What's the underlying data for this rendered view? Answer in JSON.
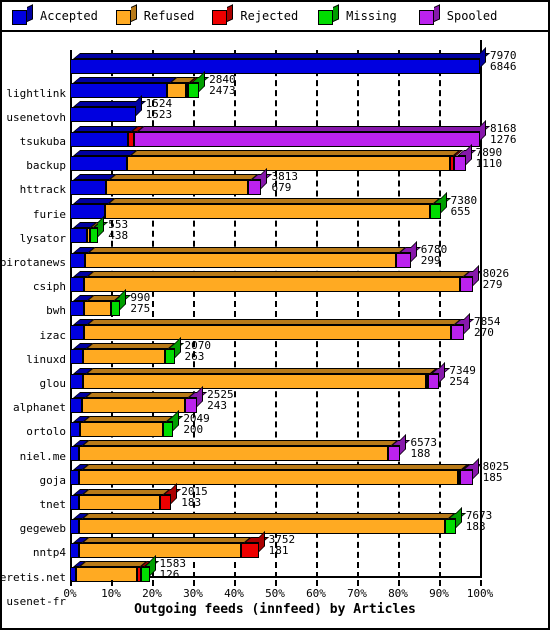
{
  "legend": {
    "items": [
      {
        "label": "Accepted",
        "color": "#0000e0",
        "name": "legend-accepted"
      },
      {
        "label": "Refused",
        "color": "#ffaa22",
        "name": "legend-refused"
      },
      {
        "label": "Rejected",
        "color": "#ee0000",
        "name": "legend-rejected"
      },
      {
        "label": "Missing",
        "color": "#00dd00",
        "name": "legend-missing"
      },
      {
        "label": "Spooled",
        "color": "#bb22ee",
        "name": "legend-spooled"
      }
    ]
  },
  "chart_data": {
    "type": "bar",
    "orientation": "horizontal",
    "stacked": true,
    "title": "Outgoing feeds (innfeed) by Articles",
    "xlabel": "Outgoing feeds (innfeed) by Articles",
    "ylabel": "",
    "xlim": [
      0,
      100
    ],
    "xunit": "%",
    "grid": true,
    "legend_position": "top",
    "xticks": [
      "0%",
      "10%",
      "20%",
      "30%",
      "40%",
      "50%",
      "60%",
      "70%",
      "80%",
      "90%",
      "100%"
    ],
    "xtick_values": [
      0,
      10,
      20,
      30,
      40,
      50,
      60,
      70,
      80,
      90,
      100
    ],
    "series": [
      {
        "name": "Accepted",
        "color": "#0000e0"
      },
      {
        "name": "Refused",
        "color": "#ffaa22"
      },
      {
        "name": "Rejected",
        "color": "#ee0000"
      },
      {
        "name": "Missing",
        "color": "#00dd00"
      },
      {
        "name": "Spooled",
        "color": "#bb22ee"
      }
    ],
    "categories": [
      "lightlink",
      "usenetovh",
      "tsukuba",
      "backup",
      "httrack",
      "furie",
      "lysator",
      "birotanews",
      "csiph",
      "bwh",
      "izac",
      "linuxd",
      "glou",
      "alphanet",
      "ortolo",
      "niel.me",
      "goja",
      "tnet",
      "gegeweb",
      "nntp4",
      "weretis.net",
      "usenet-fr"
    ],
    "rows": [
      {
        "label": "lightlink",
        "value_top": "7970",
        "value_bottom": "6846",
        "total_pct": 100.0,
        "segments": [
          {
            "series": "Accepted",
            "pct": 100.0
          }
        ]
      },
      {
        "label": "usenetovh",
        "value_top": "2840",
        "value_bottom": "2473",
        "total_pct": 31.5,
        "segments": [
          {
            "series": "Accepted",
            "pct": 23.6
          },
          {
            "series": "Refused",
            "pct": 4.6
          },
          {
            "series": "Rejected",
            "pct": 0.7
          },
          {
            "series": "Missing",
            "pct": 2.6
          }
        ]
      },
      {
        "label": "tsukuba",
        "value_top": "1524",
        "value_bottom": "1523",
        "total_pct": 16.0,
        "segments": [
          {
            "series": "Accepted",
            "pct": 16.0
          }
        ]
      },
      {
        "label": "backup",
        "value_top": "8168",
        "value_bottom": "1276",
        "total_pct": 100.0,
        "segments": [
          {
            "series": "Accepted",
            "pct": 14.1
          },
          {
            "series": "Rejected",
            "pct": 1.5
          },
          {
            "series": "Spooled",
            "pct": 84.4
          }
        ]
      },
      {
        "label": "httrack",
        "value_top": "7890",
        "value_bottom": "1110",
        "total_pct": 96.5,
        "segments": [
          {
            "series": "Accepted",
            "pct": 13.9
          },
          {
            "series": "Refused",
            "pct": 78.9
          },
          {
            "series": "Rejected",
            "pct": 0.8
          },
          {
            "series": "Spooled",
            "pct": 2.9
          }
        ]
      },
      {
        "label": "furie",
        "value_top": "3813",
        "value_bottom": "679",
        "total_pct": 46.7,
        "segments": [
          {
            "series": "Accepted",
            "pct": 8.8
          },
          {
            "series": "Refused",
            "pct": 34.6
          },
          {
            "series": "Spooled",
            "pct": 3.3
          }
        ]
      },
      {
        "label": "lysator",
        "value_top": "7380",
        "value_bottom": "655",
        "total_pct": 90.4,
        "segments": [
          {
            "series": "Accepted",
            "pct": 8.6
          },
          {
            "series": "Refused",
            "pct": 79.2
          },
          {
            "series": "Missing",
            "pct": 2.6
          }
        ]
      },
      {
        "label": "birotanews",
        "value_top": "553",
        "value_bottom": "438",
        "total_pct": 6.9,
        "segments": [
          {
            "series": "Accepted",
            "pct": 4.1
          },
          {
            "series": "Refused",
            "pct": 0.8
          },
          {
            "series": "Missing",
            "pct": 2.0
          }
        ]
      },
      {
        "label": "csiph",
        "value_top": "6780",
        "value_bottom": "299",
        "total_pct": 83.1,
        "segments": [
          {
            "series": "Accepted",
            "pct": 3.6
          },
          {
            "series": "Refused",
            "pct": 75.9
          },
          {
            "series": "Spooled",
            "pct": 3.6
          }
        ]
      },
      {
        "label": "bwh",
        "value_top": "8026",
        "value_bottom": "279",
        "total_pct": 98.2,
        "segments": [
          {
            "series": "Accepted",
            "pct": 3.4
          },
          {
            "series": "Refused",
            "pct": 91.8
          },
          {
            "series": "Spooled",
            "pct": 3.0
          }
        ]
      },
      {
        "label": "izac",
        "value_top": "990",
        "value_bottom": "275",
        "total_pct": 12.3,
        "segments": [
          {
            "series": "Accepted",
            "pct": 3.3
          },
          {
            "series": "Refused",
            "pct": 6.6
          },
          {
            "series": "Missing",
            "pct": 2.4
          }
        ]
      },
      {
        "label": "linuxd",
        "value_top": "7854",
        "value_bottom": "270",
        "total_pct": 96.1,
        "segments": [
          {
            "series": "Accepted",
            "pct": 3.3
          },
          {
            "series": "Refused",
            "pct": 89.6
          },
          {
            "series": "Spooled",
            "pct": 3.2
          }
        ]
      },
      {
        "label": "glou",
        "value_top": "2070",
        "value_bottom": "263",
        "total_pct": 25.5,
        "segments": [
          {
            "series": "Accepted",
            "pct": 3.2
          },
          {
            "series": "Refused",
            "pct": 20.0
          },
          {
            "series": "Missing",
            "pct": 2.3
          }
        ]
      },
      {
        "label": "alphanet",
        "value_top": "7349",
        "value_bottom": "254",
        "total_pct": 90.1,
        "segments": [
          {
            "series": "Accepted",
            "pct": 3.1
          },
          {
            "series": "Refused",
            "pct": 83.8
          },
          {
            "series": "Rejected",
            "pct": 0.3
          },
          {
            "series": "Spooled",
            "pct": 2.9
          }
        ]
      },
      {
        "label": "ortolo",
        "value_top": "2525",
        "value_bottom": "243",
        "total_pct": 31.0,
        "segments": [
          {
            "series": "Accepted",
            "pct": 3.0
          },
          {
            "series": "Refused",
            "pct": 25.0
          },
          {
            "series": "Spooled",
            "pct": 3.0
          }
        ]
      },
      {
        "label": "niel.me",
        "value_top": "2049",
        "value_bottom": "200",
        "total_pct": 25.2,
        "segments": [
          {
            "series": "Accepted",
            "pct": 2.5
          },
          {
            "series": "Refused",
            "pct": 20.3
          },
          {
            "series": "Missing",
            "pct": 2.4
          }
        ]
      },
      {
        "label": "goja",
        "value_top": "6573",
        "value_bottom": "188",
        "total_pct": 80.6,
        "segments": [
          {
            "series": "Accepted",
            "pct": 2.3
          },
          {
            "series": "Refused",
            "pct": 75.3
          },
          {
            "series": "Spooled",
            "pct": 3.0
          }
        ]
      },
      {
        "label": "tnet",
        "value_top": "8025",
        "value_bottom": "185",
        "total_pct": 98.2,
        "segments": [
          {
            "series": "Accepted",
            "pct": 2.3
          },
          {
            "series": "Refused",
            "pct": 92.4
          },
          {
            "series": "Rejected",
            "pct": 0.5
          },
          {
            "series": "Spooled",
            "pct": 3.0
          }
        ]
      },
      {
        "label": "gegeweb",
        "value_top": "2015",
        "value_bottom": "183",
        "total_pct": 24.7,
        "segments": [
          {
            "series": "Accepted",
            "pct": 2.2
          },
          {
            "series": "Refused",
            "pct": 19.8
          },
          {
            "series": "Rejected",
            "pct": 2.7
          }
        ]
      },
      {
        "label": "nntp4",
        "value_top": "7673",
        "value_bottom": "183",
        "total_pct": 94.1,
        "segments": [
          {
            "series": "Accepted",
            "pct": 2.2
          },
          {
            "series": "Refused",
            "pct": 89.3
          },
          {
            "series": "Missing",
            "pct": 2.6
          }
        ]
      },
      {
        "label": "weretis.net",
        "value_top": "3752",
        "value_bottom": "181",
        "total_pct": 46.0,
        "segments": [
          {
            "series": "Accepted",
            "pct": 2.2
          },
          {
            "series": "Refused",
            "pct": 39.5
          },
          {
            "series": "Rejected",
            "pct": 4.3
          }
        ]
      },
      {
        "label": "usenet-fr",
        "value_top": "1583",
        "value_bottom": "126",
        "total_pct": 19.4,
        "segments": [
          {
            "series": "Accepted",
            "pct": 1.5
          },
          {
            "series": "Refused",
            "pct": 14.9
          },
          {
            "series": "Rejected",
            "pct": 1.0
          },
          {
            "series": "Missing",
            "pct": 2.0
          }
        ]
      }
    ]
  }
}
